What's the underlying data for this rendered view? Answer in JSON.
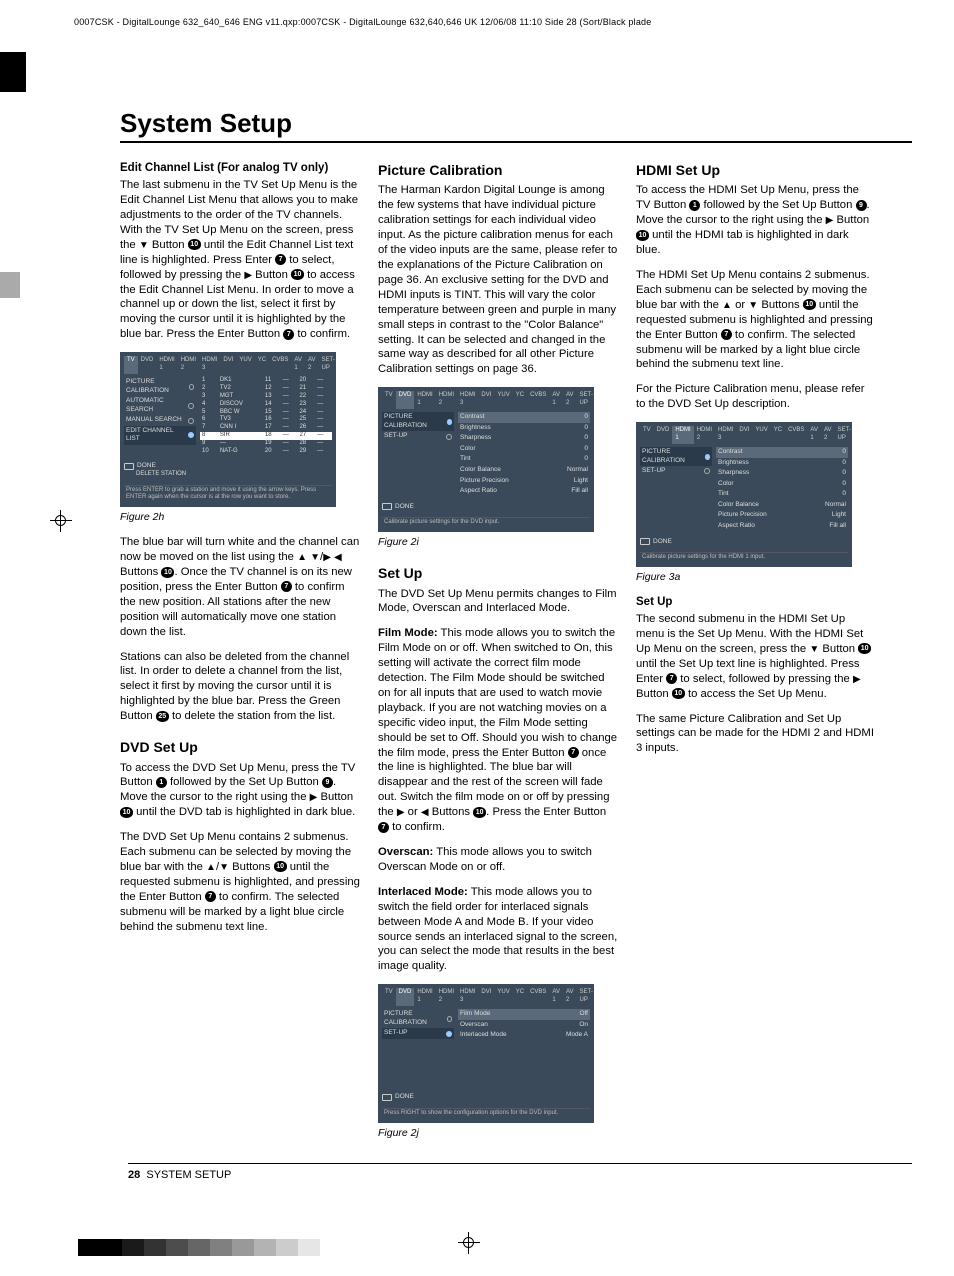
{
  "crop_line": "0007CSK - DigitalLounge 632_640_646 ENG v11.qxp:0007CSK - DigitalLounge 632,640,646 UK  12/06/08  11:10  Side 28   (Sort/Black plade",
  "page_title": "System Setup",
  "footer": {
    "num": "28",
    "section": "SYSTEM SETUP"
  },
  "glyph": {
    "up": "▲",
    "down": "▼",
    "left": "◀",
    "right": "▶",
    "b1": "1",
    "b7": "7",
    "b9": "9",
    "b10": "10",
    "b25": "25"
  },
  "col1": {
    "h_edit": "Edit Channel List (For analog TV only)",
    "p1a": "The last submenu in the TV Set Up Menu is the Edit Channel List Menu that allows you to make adjustments to the order of the TV channels. With the TV Set Up Menu on the screen, press the ",
    "p1b": " Button ",
    "p1c": " until the Edit Channel List text line is highlighted. Press Enter ",
    "p1d": " to select, followed by pressing the ",
    "p1e": " Button ",
    "p1f": " to access the Edit Channel List Menu. In order to move a channel up or down the list, select it first by moving the cursor until it is highlighted by the blue bar. Press the Enter Button ",
    "p1g": " to confirm.",
    "fig2h": "Figure 2h",
    "p2a": "The blue bar will turn white and the channel can now be moved on the list using the ",
    "p2b": " Buttons ",
    "p2c": ". Once the TV channel is on its new position, press the Enter Button ",
    "p2d": " to confirm the new position. All stations after the new position will automatically move one station down the list.",
    "p3a": "Stations can also be deleted from the channel list. In order to delete a channel from the list, select it first by moving the cursor until it is highlighted by the blue bar. Press the Green Button ",
    "p3b": " to delete the station from the list.",
    "h_dvd": "DVD Set Up",
    "p4a": "To access the DVD Set Up Menu, press the TV Button ",
    "p4b": " followed by the Set Up Button ",
    "p4c": ". Move the cursor to the right using the ",
    "p4d": " Button ",
    "p4e": " until the DVD tab is highlighted in dark blue.",
    "p5a": "The DVD Set Up Menu contains 2 submenus. Each submenu can be selected by moving the blue bar with the ",
    "p5b": " Buttons ",
    "p5c": " until the requested submenu is highlighted, and pressing the Enter Button ",
    "p5d": " to confirm. The selected submenu will be marked by a light blue circle behind the submenu text line."
  },
  "col2": {
    "h_pc": "Picture Calibration",
    "p1": "The Harman Kardon Digital Lounge is among the few systems that have individual picture calibration settings for each individual video input. As the picture calibration menus for each of the video inputs are the same, please refer to the explanations of the Picture Calibration on page 36. An exclusive setting for the DVD and HDMI inputs is TINT. This will vary the color temperature between green and purple in many small steps in contrast to the \"Color Balance\" setting. It can be selected and changed in the same way as described for all other Picture Calibration settings on page 36.",
    "fig2i": "Figure 2i",
    "h_setup": "Set Up",
    "p2": "The DVD Set Up Menu permits changes to Film Mode, Overscan and Interlaced Mode.",
    "p3a_b": "Film Mode:",
    "p3a": " This mode allows you to switch the Film Mode on or off. When switched to On, this setting will activate the correct film mode detection. The Film Mode should be switched on for all inputs that are used to watch movie playback. If you are not watching movies on a specific video input, the Film Mode setting should be set to Off. Should you wish to change the film mode, press the Enter Button ",
    "p3b": " once the line is highlighted. The blue bar will disappear and the rest of the screen will fade out. Switch the film mode on or off by pressing the ",
    "p3c": " or ",
    "p3d": " Buttons ",
    "p3e": ". Press the Enter Button ",
    "p3f": " to confirm.",
    "p4a_b": "Overscan:",
    "p4a": " This mode allows you to switch Overscan Mode on or off.",
    "p5a_b": "Interlaced Mode:",
    "p5a": " This mode allows you to switch the field order for interlaced signals between Mode A and Mode B. If your video source sends an interlaced signal to the screen, you can select the mode that results in the best image quality.",
    "fig2j": "Figure 2j"
  },
  "col3": {
    "h_hdmi": "HDMI Set Up",
    "p1a": "To access the HDMI Set Up Menu, press the TV Button ",
    "p1b": " followed by the Set Up Button ",
    "p1c": ". Move the cursor to the right using the ",
    "p1d": " Button ",
    "p1e": " until the HDMI tab is highlighted in dark blue.",
    "p2a": "The HDMI Set Up Menu contains 2 submenus. Each submenu can be selected by moving the blue bar with the ",
    "p2b": " or ",
    "p2c": " Buttons ",
    "p2d": " until the requested submenu is highlighted and pressing the Enter Button ",
    "p2e": " to confirm. The selected submenu will be marked by a light blue circle behind the submenu text line.",
    "p3": "For the Picture Calibration menu, please refer to the DVD Set Up description.",
    "fig3a": "Figure 3a",
    "h_setup": "Set Up",
    "p4a": "The second submenu in the HDMI Set Up menu is the Set Up Menu. With the HDMI Set Up Menu on the screen, press the ",
    "p4b": " Button ",
    "p4c": " until the Set Up text line is highlighted. Press Enter ",
    "p4d": " to select, followed by pressing the ",
    "p4e": " Button ",
    "p4f": " to access the Set Up Menu.",
    "p5": "The same Picture Calibration and Set Up settings can be made for the HDMI 2 and HDMI 3 inputs."
  },
  "osd": {
    "tabs": [
      "TV",
      "DVD",
      "HDMI 1",
      "HDMI 2",
      "HDMI 3",
      "DVI",
      "YUV",
      "YC",
      "CVBS",
      "AV 1",
      "AV 2",
      "SET-UP"
    ],
    "fig2h": {
      "sel_tab": "TV",
      "side": [
        "PICTURE CALIBRATION",
        "AUTOMATIC SEARCH",
        "MANUAL SEARCH",
        "EDIT CHANNEL LIST"
      ],
      "side_sel": 3,
      "rows": [
        [
          "1",
          "DK1",
          "11",
          "—",
          "20",
          "—"
        ],
        [
          "2",
          "TV2",
          "12",
          "—",
          "21",
          "—"
        ],
        [
          "3",
          "MGT",
          "13",
          "—",
          "22",
          "—"
        ],
        [
          "4",
          "DISCOV",
          "14",
          "—",
          "23",
          "—"
        ],
        [
          "5",
          "BBC W",
          "15",
          "—",
          "24",
          "—"
        ],
        [
          "6",
          "TV3",
          "16",
          "—",
          "25",
          "—"
        ],
        [
          "7",
          "CNN I",
          "17",
          "—",
          "26",
          "—"
        ],
        [
          "8",
          "SIR",
          "18",
          "—",
          "27",
          "—"
        ],
        [
          "9",
          "—",
          "19",
          "—",
          "28",
          "—"
        ],
        [
          "10",
          "NAT-G",
          "20",
          "—",
          "29",
          "—"
        ]
      ],
      "hi_row": 7,
      "done": "DONE",
      "sub": "DELETE STATION",
      "foot": "Press ENTER to grab a station and move it using the arrow keys.\nPress ENTER again when the cursor is at the row you want to store."
    },
    "fig2i": {
      "sel_tab": "DVD",
      "side": [
        "PICTURE CALIBRATION",
        "SET-UP"
      ],
      "side_sel": 0,
      "rows": [
        [
          "Contrast",
          "0"
        ],
        [
          "Brightness",
          "0"
        ],
        [
          "Sharpness",
          "0"
        ],
        [
          "Color",
          "0"
        ],
        [
          "Tint",
          "0"
        ],
        [
          "Color Balance",
          "Normal"
        ],
        [
          "Picture Precision",
          "Light"
        ],
        [
          "Aspect Ratio",
          "Fill all"
        ]
      ],
      "done": "DONE",
      "foot": "Calibrate picture settings for the DVD input."
    },
    "fig2j": {
      "sel_tab": "DVD",
      "side": [
        "PICTURE CALIBRATION",
        "SET-UP"
      ],
      "side_sel": 1,
      "rows": [
        [
          "Film Mode",
          "Off"
        ],
        [
          "Overscan",
          "On"
        ],
        [
          "Interlaced Mode",
          "Mode A"
        ]
      ],
      "done": "DONE",
      "foot": "Press RIGHT to show the configuration options for the DVD input."
    },
    "fig3a": {
      "sel_tab": "HDMI 1",
      "side": [
        "PICTURE CALIBRATION",
        "SET-UP"
      ],
      "side_sel": 0,
      "rows": [
        [
          "Contrast",
          "0"
        ],
        [
          "Brightness",
          "0"
        ],
        [
          "Sharpness",
          "0"
        ],
        [
          "Color",
          "0"
        ],
        [
          "Tint",
          "0"
        ],
        [
          "Color Balance",
          "Normal"
        ],
        [
          "Picture Precision",
          "Light"
        ],
        [
          "Aspect Ratio",
          "Fill all"
        ]
      ],
      "done": "DONE",
      "foot": "Calibrate picture settings for the HDMI 1 input."
    }
  },
  "colorbar_colors": [
    "#000",
    "#000",
    "#1a1a1a",
    "#333",
    "#4d4d4d",
    "#666",
    "#808080",
    "#999",
    "#b3b3b3",
    "#ccc",
    "#e6e6e6"
  ]
}
